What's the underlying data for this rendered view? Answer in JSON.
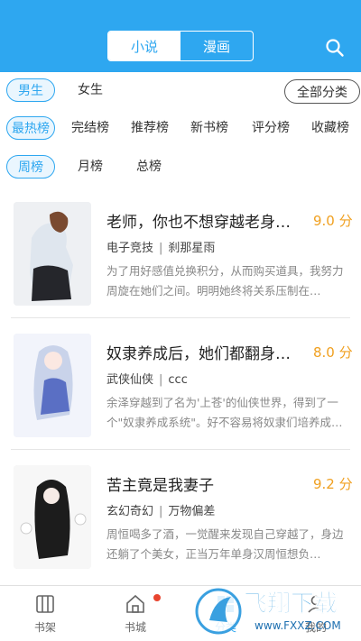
{
  "header": {
    "tabs": [
      "小说",
      "漫画"
    ]
  },
  "filters": {
    "gender": [
      "男生",
      "女生"
    ],
    "all_categories": "全部分类",
    "rank_types": [
      "最热榜",
      "完结榜",
      "推荐榜",
      "新书榜",
      "评分榜",
      "收藏榜"
    ],
    "periods": [
      "周榜",
      "月榜",
      "总榜"
    ]
  },
  "books": [
    {
      "title": "老师，你也不想穿越老身…",
      "score": "9.0 分",
      "category": "电子竞技",
      "author": "刹那星雨",
      "desc": "为了用好感值兑换积分，从而购买道具，我努力周旋在她们之间。明明她终将关系压制在…"
    },
    {
      "title": "奴隶养成后，她们都翻身…",
      "score": "8.0 分",
      "category": "武侠仙侠",
      "author": "ccc",
      "desc": "余泽穿越到了名为'上苍'的仙侠世界，得到了一个\"奴隶养成系统\"。好不容易将奴隶们培养成…"
    },
    {
      "title": "苦主竟是我妻子",
      "score": "9.2 分",
      "category": "玄幻奇幻",
      "author": "万物偏差",
      "desc": "周恒喝多了酒，一觉醒来发现自己穿越了，身边还躺了个美女，正当万年单身汉周恒想负…"
    }
  ],
  "tabbar": [
    "书架",
    "书城",
    "分类",
    "我的"
  ],
  "watermark": {
    "brand": "飞翔下载",
    "url": "www.FXXZ.COM"
  }
}
